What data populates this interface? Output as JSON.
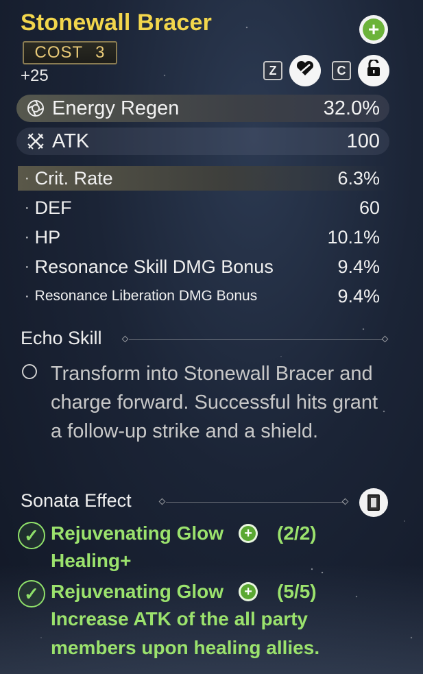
{
  "echo": {
    "name": "Stonewall Bracer",
    "cost_label": "COST",
    "cost_value": "3",
    "level": "+25"
  },
  "controls": {
    "discard_key": "Z",
    "lock_key": "C"
  },
  "main_stats": [
    {
      "label": "Energy Regen",
      "value": "32.0%",
      "icon": "energy-regen-icon"
    },
    {
      "label": "ATK",
      "value": "100",
      "icon": "atk-swords-icon"
    }
  ],
  "sub_stats": [
    {
      "label": "Crit. Rate",
      "value": "6.3%"
    },
    {
      "label": "DEF",
      "value": "60"
    },
    {
      "label": "HP",
      "value": "10.1%"
    },
    {
      "label": "Resonance Skill DMG Bonus",
      "value": "9.4%"
    },
    {
      "label": "Resonance Liberation DMG Bonus",
      "value": "9.4%"
    }
  ],
  "echo_skill": {
    "heading": "Echo Skill",
    "description": "Transform into Stonewall Bracer and charge forward. Successful hits grant a follow-up strike and a shield."
  },
  "sonata": {
    "heading": "Sonata Effect",
    "effects": [
      {
        "name": "Rejuvenating Glow",
        "count": "(2/2)",
        "description": "Healing+"
      },
      {
        "name": "Rejuvenating Glow",
        "count": "(5/5)",
        "description": "Increase ATK of the all party members upon healing allies."
      }
    ]
  },
  "colors": {
    "title": "#f2d64c",
    "active_effect": "#9be26d",
    "cost_text": "#e8c977"
  }
}
